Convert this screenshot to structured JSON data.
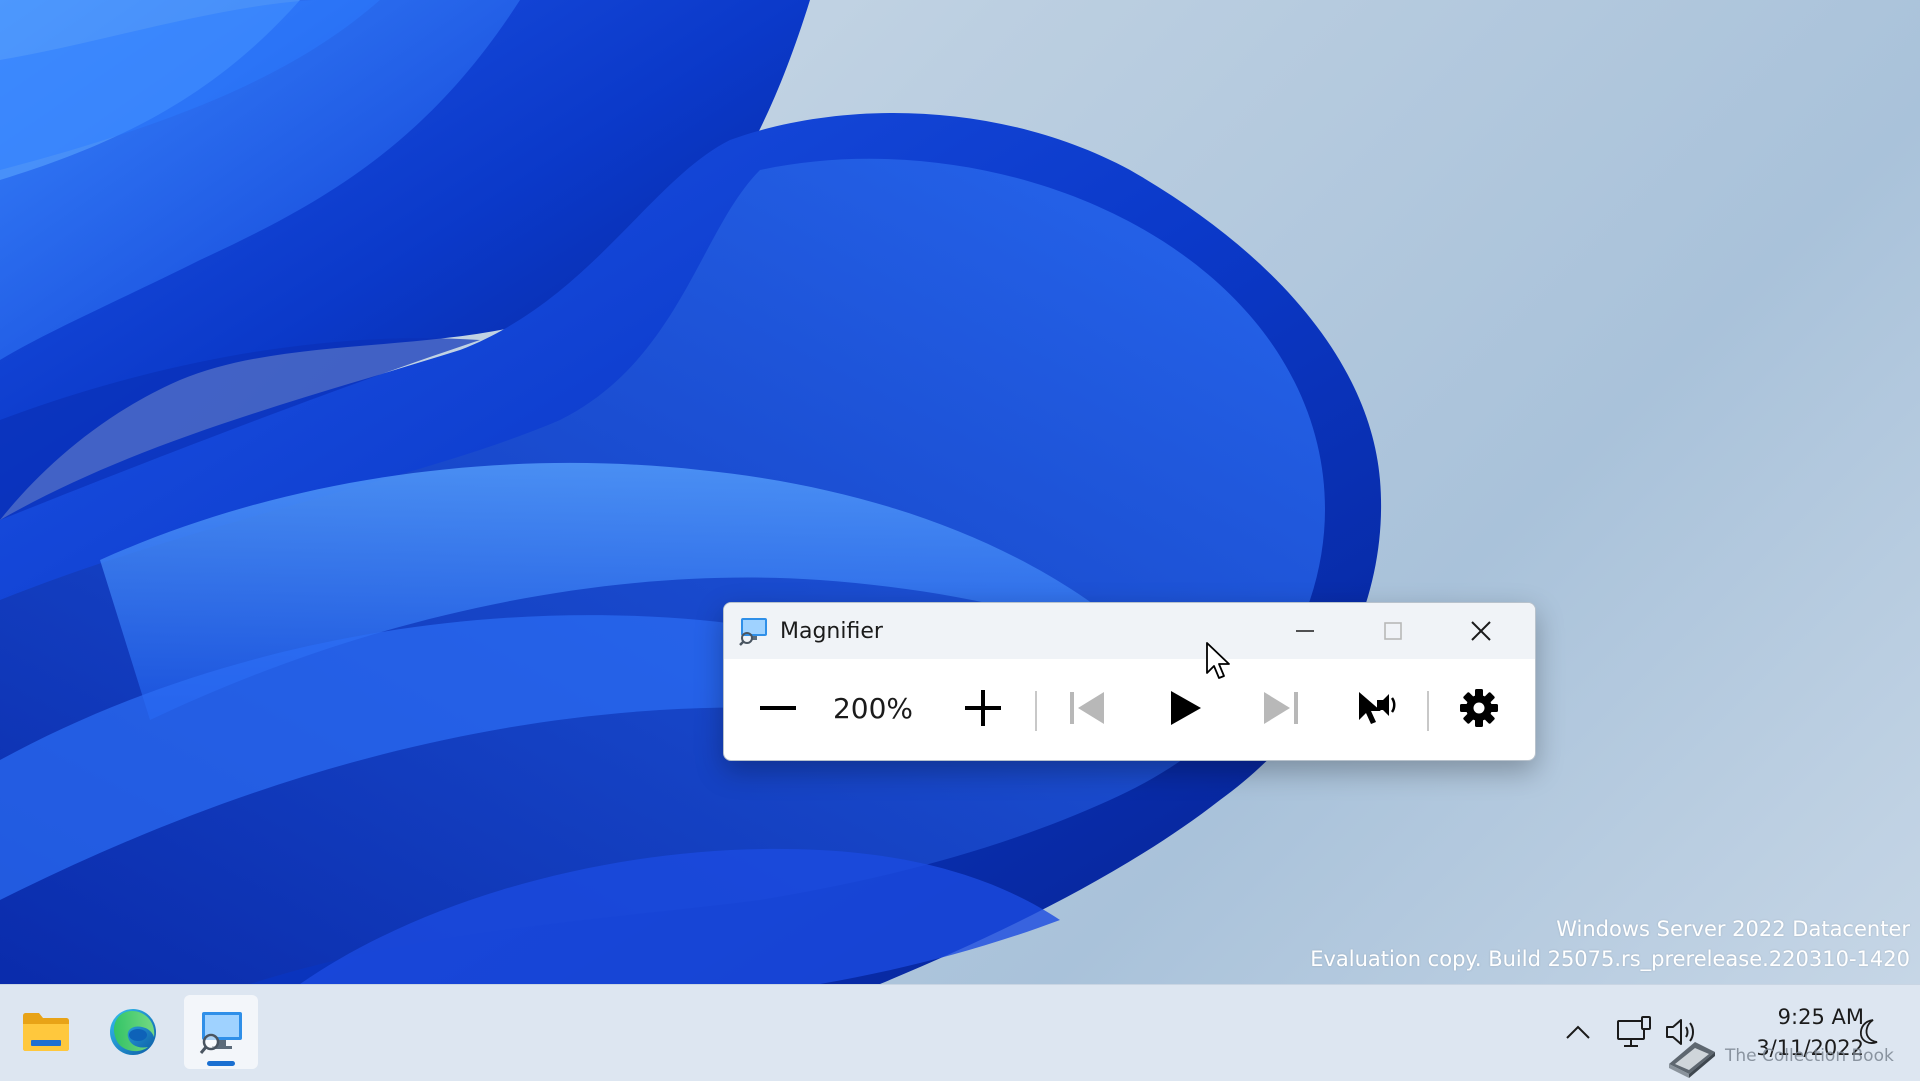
{
  "desktop": {
    "watermark": {
      "line1": "Windows Server 2022 Datacenter",
      "line2": "Evaluation copy. Build 25075.rs_prerelease.220310-1420"
    }
  },
  "magnifier": {
    "title": "Magnifier",
    "zoom_level": "200%",
    "caption_buttons": [
      "minimize",
      "maximize",
      "close"
    ],
    "toolbar_buttons": [
      "zoom-out",
      "zoom-in",
      "previous",
      "play",
      "next",
      "read-from-here",
      "settings"
    ],
    "colors": {
      "titlebar": "#f0f3f7",
      "icon": "#000000",
      "disabled_icon": "#b8b8b8"
    }
  },
  "taskbar": {
    "apps": [
      "file-explorer",
      "microsoft-edge",
      "magnifier"
    ],
    "active_app": "magnifier",
    "clock": {
      "time": "9:25 AM",
      "date": "3/11/2022"
    },
    "tray": [
      "show-hidden-icons",
      "network",
      "volume",
      "focus-assist"
    ],
    "overlay_text": "The Collection Book",
    "colors": {
      "accent": "#1a6fd1",
      "background": "#dde6f1"
    }
  }
}
